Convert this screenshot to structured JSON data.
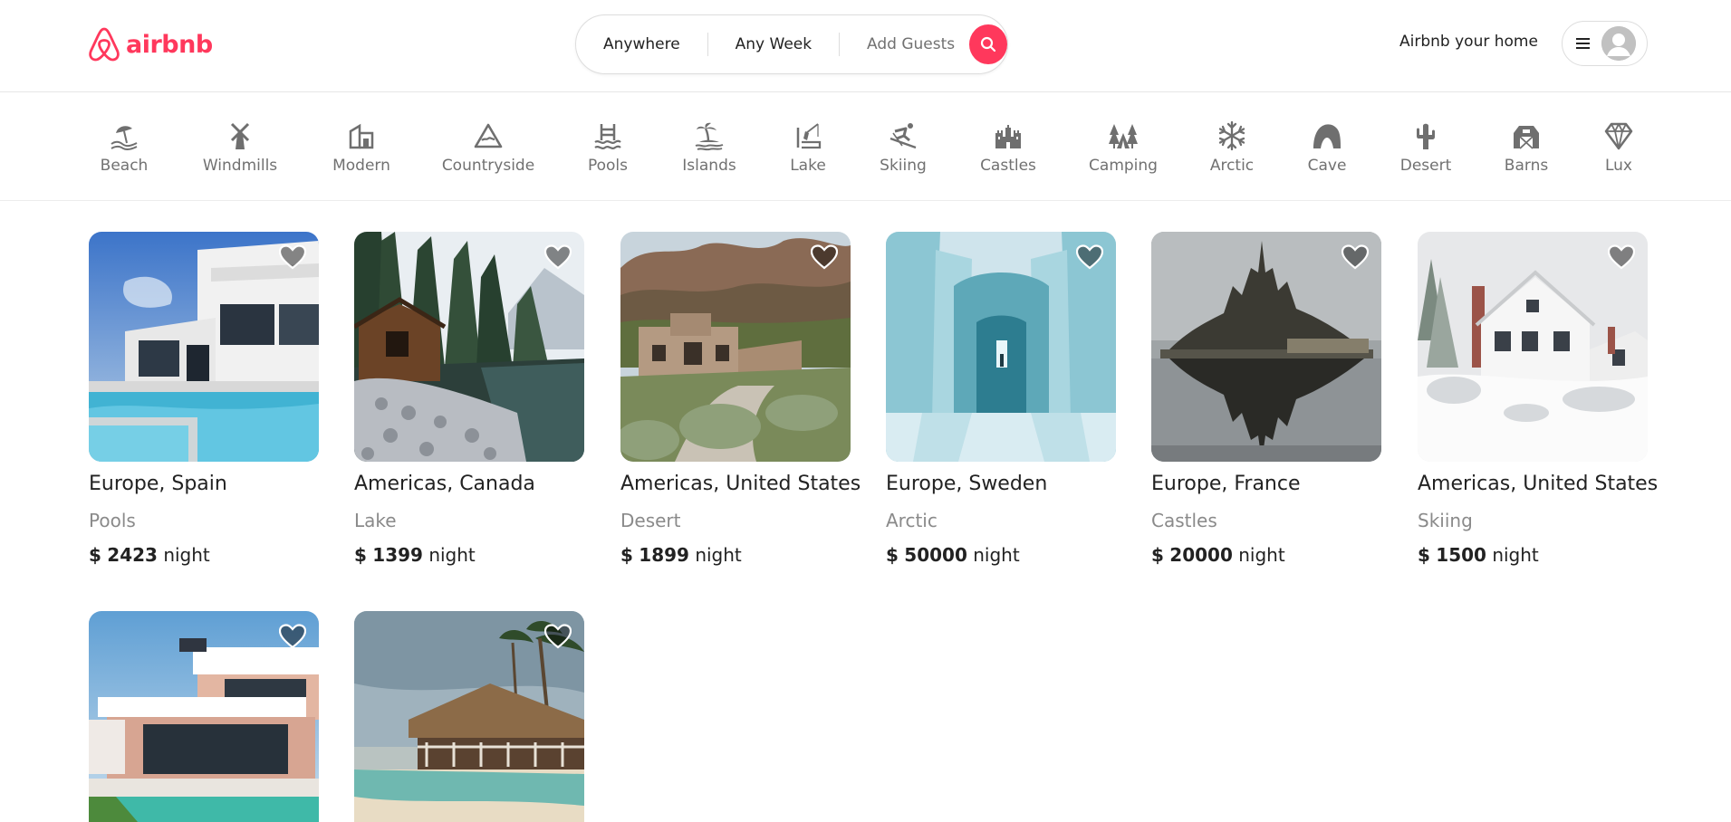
{
  "brand": {
    "name": "airbnb",
    "color": "#ff385c"
  },
  "search": {
    "where": "Anywhere",
    "when": "Any Week",
    "guests": "Add Guests"
  },
  "header": {
    "host_link": "Airbnb your home"
  },
  "categories": [
    {
      "label": "Beach",
      "icon": "beach-icon"
    },
    {
      "label": "Windmills",
      "icon": "windmill-icon"
    },
    {
      "label": "Modern",
      "icon": "modern-house-icon"
    },
    {
      "label": "Countryside",
      "icon": "mountain-icon"
    },
    {
      "label": "Pools",
      "icon": "pool-icon"
    },
    {
      "label": "Islands",
      "icon": "island-icon"
    },
    {
      "label": "Lake",
      "icon": "lake-icon"
    },
    {
      "label": "Skiing",
      "icon": "skiing-icon"
    },
    {
      "label": "Castles",
      "icon": "castle-icon"
    },
    {
      "label": "Camping",
      "icon": "camping-icon"
    },
    {
      "label": "Arctic",
      "icon": "snowflake-icon"
    },
    {
      "label": "Cave",
      "icon": "cave-icon"
    },
    {
      "label": "Desert",
      "icon": "cactus-icon"
    },
    {
      "label": "Barns",
      "icon": "barn-icon"
    },
    {
      "label": "Lux",
      "icon": "diamond-icon"
    }
  ],
  "listings": [
    {
      "location": "Europe, Spain",
      "category": "Pools",
      "currency": "$",
      "price": "2423",
      "unit": "night"
    },
    {
      "location": "Americas, Canada",
      "category": "Lake",
      "currency": "$",
      "price": "1399",
      "unit": "night"
    },
    {
      "location": "Americas, United States",
      "category": "Desert",
      "currency": "$",
      "price": "1899",
      "unit": "night"
    },
    {
      "location": "Europe, Sweden",
      "category": "Arctic",
      "currency": "$",
      "price": "50000",
      "unit": "night"
    },
    {
      "location": "Europe, France",
      "category": "Castles",
      "currency": "$",
      "price": "20000",
      "unit": "night"
    },
    {
      "location": "Americas, United States",
      "category": "Skiing",
      "currency": "$",
      "price": "1500",
      "unit": "night"
    }
  ]
}
